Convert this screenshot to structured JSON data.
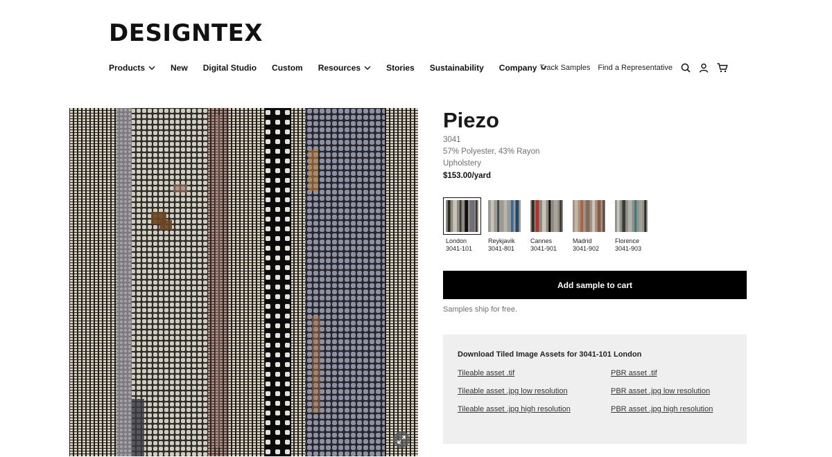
{
  "brand": {
    "logo_text": "DESIGNTEX"
  },
  "nav": {
    "items": [
      {
        "label": "Products",
        "has_dropdown": true
      },
      {
        "label": "New",
        "has_dropdown": false
      },
      {
        "label": "Digital Studio",
        "has_dropdown": false
      },
      {
        "label": "Custom",
        "has_dropdown": false
      },
      {
        "label": "Resources",
        "has_dropdown": true
      },
      {
        "label": "Stories",
        "has_dropdown": false
      },
      {
        "label": "Sustainability",
        "has_dropdown": false
      },
      {
        "label": "Company",
        "has_dropdown": true
      }
    ],
    "utility_links": [
      "Track Samples",
      "Find a Representative"
    ],
    "icons": [
      "search-icon",
      "user-icon",
      "cart-icon"
    ]
  },
  "product": {
    "name": "Piezo",
    "number": "3041",
    "content": "57% Polyester, 43% Rayon",
    "application": "Upholstery",
    "price": "$153.00/yard",
    "image_action_icon": "expand-icon",
    "colorways": [
      {
        "name": "London",
        "code": "3041-101",
        "selected": true,
        "accent": "#3a3a38"
      },
      {
        "name": "Reykjavik",
        "code": "3041-801",
        "selected": false,
        "accent": "#3f6a96"
      },
      {
        "name": "Cannes",
        "code": "3041-901",
        "selected": false,
        "accent": "#b4302a"
      },
      {
        "name": "Madrid",
        "code": "3041-902",
        "selected": false,
        "accent": "#b0603e"
      },
      {
        "name": "Florence",
        "code": "3041-903",
        "selected": false,
        "accent": "#2e7d78"
      }
    ],
    "add_sample_label": "Add sample to cart",
    "shipping_note": "Samples ship for free."
  },
  "downloads": {
    "title": "Download Tiled Image Assets for 3041-101 London",
    "links": [
      "Tileable asset .tif",
      "PBR asset .tif",
      "Tileable asset .jpg low resolution",
      "PBR asset .jpg low resolution",
      "Tileable asset .jpg high resolution",
      "PBR asset .jpg high resolution"
    ]
  },
  "colors": {
    "button_bg": "#000000",
    "downloads_bg": "#efefef",
    "muted_text": "#707070"
  }
}
